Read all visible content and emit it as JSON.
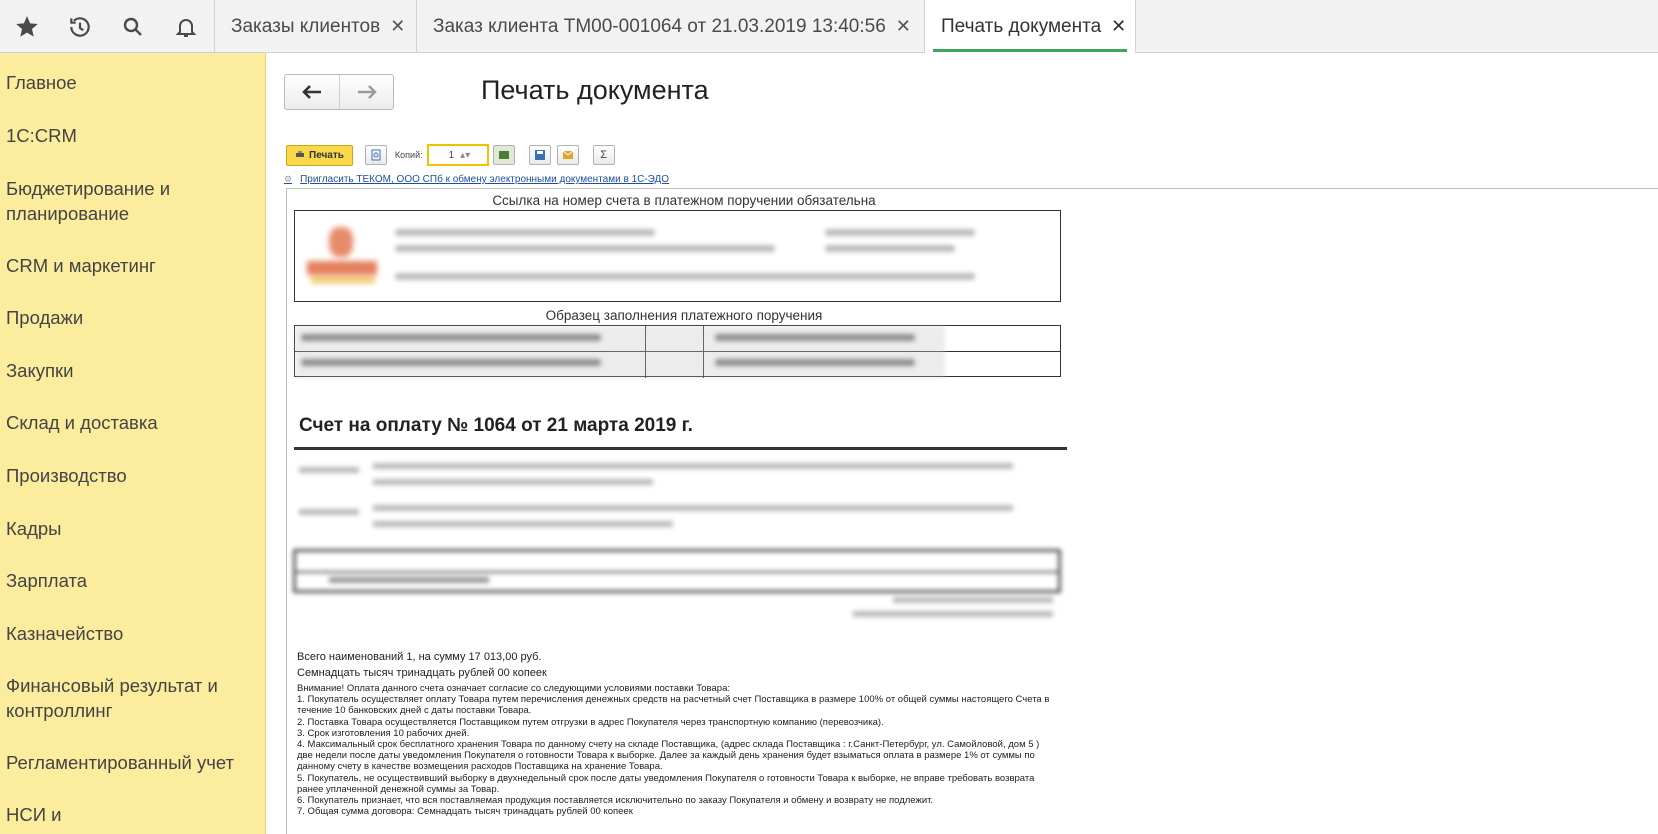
{
  "tabs": [
    {
      "label": "Заказы клиентов"
    },
    {
      "label": "Заказ клиента ТМ00-001064 от 21.03.2019 13:40:56"
    },
    {
      "label": "Печать документа"
    }
  ],
  "sidebar": {
    "items": [
      {
        "label": "Главное"
      },
      {
        "label": "1С:CRM"
      },
      {
        "label": "Бюджетирование и планирование"
      },
      {
        "label": "CRM и маркетинг"
      },
      {
        "label": "Продажи"
      },
      {
        "label": "Закупки"
      },
      {
        "label": "Склад и доставка"
      },
      {
        "label": "Производство"
      },
      {
        "label": "Кадры"
      },
      {
        "label": "Зарплата"
      },
      {
        "label": "Казначейство"
      },
      {
        "label": "Финансовый результат и контроллинг"
      },
      {
        "label": "Регламентированный учет"
      },
      {
        "label": "НСИ и администрирование"
      }
    ]
  },
  "page": {
    "title": "Печать документа"
  },
  "toolbar": {
    "print_label": "Печать",
    "copies_label": "Копий:",
    "copies_value": "1",
    "sum_label": "Σ"
  },
  "edo_link": "Пригласить ТЕКОМ, ООО СПб к обмену электронными документами в 1С-ЭДО",
  "document": {
    "caption_top": "Ссылка на номер счета в платежном поручении обязательна",
    "caption_sample": "Образец заполнения платежного поручения",
    "invoice_title": "Счет на оплату № 1064 от 21 марта 2019 г.",
    "total_line": "Всего наименований 1, на сумму 17 013,00 руб.",
    "total_words": "Семнадцать тысяч тринадцать рублей 00 копеек",
    "terms": [
      "Внимание! Оплата данного счета означает согласие со следующими условиями поставки Товара:",
      "1. Покупатель осуществляет оплату Товара путем перечисления денежных средств на расчетный счет Поставщика в размере 100% от общей суммы настоящего Счета в течение 10 банковских дней с даты поставки Товара.",
      "2. Поставка Товара осуществляется Поставщиком путем отгрузки в адрес Покупателя через транспортную компанию (перевозчика).",
      "3. Срок изготовления 10 рабочих дней.",
      "4. Максимальный срок бесплатного хранения Товара по данному счету на складе Поставщика, (адрес склада Поставщика : г.Санкт-Петербург, ул. Самойловой, дом 5 ) две недели после даты уведомления Покупателя о готовности Товара к выборке. Далее за каждый день хранения будет взыматься оплата в размере 1% от суммы по данному счету в качестве возмещения расходов Поставщика на хранение Товара.",
      "5. Покупатель, не осуществивший выборку в двухнедельный срок после даты уведомления Покупателя о готовности Товара к выборке, не вправе требовать возврата ранее уплаченной денежной суммы за Товар.",
      "6. Покупатель признает, что вся поставляемая продукция поставляется исключительно по заказу Покупателя и обмену и возврату не подлежит.",
      "7. Общая сумма договора: Семнадцать тысяч тринадцать рублей 00 копеек"
    ]
  },
  "colors": {
    "sidebar_bg": "#fbec9e",
    "active_tab_accent": "#3fa35f",
    "print_button": "#f9d84a",
    "link": "#1c4fa3"
  }
}
